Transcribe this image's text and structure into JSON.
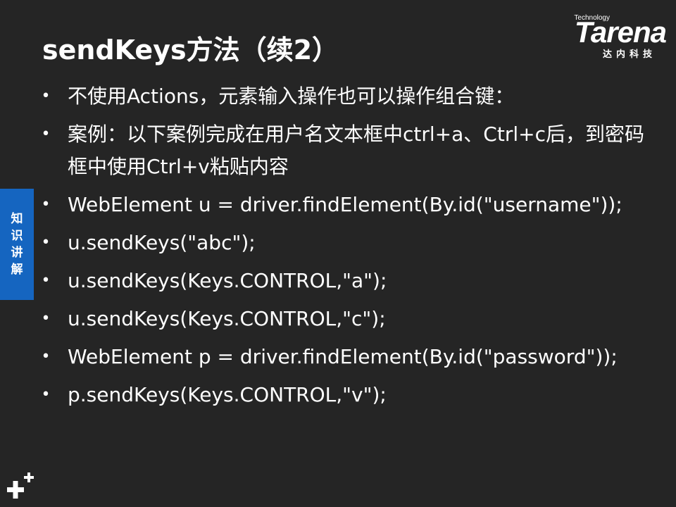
{
  "slide": {
    "title": "sendKeys方法（续2）"
  },
  "logo": {
    "small": "Technology",
    "main": "Tarena",
    "sub": "达内科技"
  },
  "side_tab": {
    "chars": [
      "知",
      "识",
      "讲",
      "解"
    ]
  },
  "bullets": [
    "不使用Actions，元素输入操作也可以操作组合键：",
    "案例：以下案例完成在用户名文本框中ctrl+a、Ctrl+c后，到密码框中使用Ctrl+v粘贴内容",
    "WebElement u = driver.findElement(By.id(\"username\"));",
    "u.sendKeys(\"abc\");",
    "u.sendKeys(Keys.CONTROL,\"a\");",
    "u.sendKeys(Keys.CONTROL,\"c\");",
    "WebElement p = driver.findElement(By.id(\"password\"));",
    "p.sendKeys(Keys.CONTROL,\"v\");"
  ],
  "colors": {
    "background": "#252525",
    "side_tab": "#1565c0",
    "text": "#ffffff"
  }
}
